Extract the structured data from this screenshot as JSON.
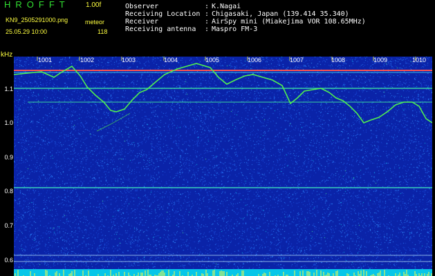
{
  "header": {
    "app_title": "HROFFT",
    "version": "1.00f",
    "filename": "KN9_2505291000.png",
    "mode": "meteor",
    "datetime": "25.05.29 10:00",
    "count": "118",
    "info": [
      {
        "label": "Observer",
        "value": "K.Nagai"
      },
      {
        "label": "Receiving Location",
        "value": "Chigasaki, Japan (139.414 35.340)"
      },
      {
        "label": "Receiver",
        "value": "AirSpy mini (Miakejima VOR 108.65MHz)"
      },
      {
        "label": "Receiving antenna",
        "value": "Maspro FM-3"
      }
    ],
    "separator": ":"
  },
  "spectrogram": {
    "unit_label": "kHz",
    "y_ticks": [
      "1.1",
      "1.0",
      "0.9",
      "0.8",
      "0.7",
      "0.6"
    ],
    "x_ticks": [
      "1001",
      "1002",
      "1003",
      "1004",
      "1005",
      "1006",
      "1007",
      "1008",
      "1009",
      "1010"
    ],
    "colors": {
      "background": "#0a23a8",
      "noise_dot": "#2a86ff",
      "trace": "#40f040",
      "carrier": "#ff5050",
      "bottom_band": "#06c6e8",
      "bottom_signal": "#ffff40"
    }
  }
}
